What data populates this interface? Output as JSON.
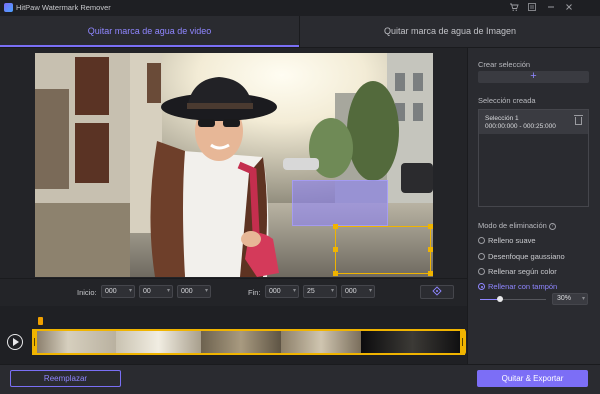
{
  "app": {
    "title": "HitPaw Watermark Remover"
  },
  "window_controls": [
    "cart-icon",
    "menu-icon",
    "minimize-icon",
    "close-icon"
  ],
  "tabs": [
    {
      "label": "Quitar marca de agua de video",
      "active": true
    },
    {
      "label": "Quitar marca de agua de Imagen",
      "active": false
    }
  ],
  "controls": {
    "start_label": "Inicio:",
    "start": [
      "000",
      "00",
      "000"
    ],
    "end_label": "Fin:",
    "end": [
      "000",
      "25",
      "000"
    ]
  },
  "panel": {
    "create_label": "Crear selección",
    "add_symbol": "+",
    "created_label": "Selección creada",
    "selection": {
      "name": "Selección 1",
      "range": "000:00:000 - 000:25:000"
    },
    "mode_label": "Modo de eliminación",
    "modes": [
      {
        "label": "Relleno suave",
        "selected": false
      },
      {
        "label": "Desenfoque gaussiano",
        "selected": false
      },
      {
        "label": "Rellenar según color",
        "selected": false
      },
      {
        "label": "Rellenar con tampón",
        "selected": true
      }
    ],
    "opacity": {
      "value": "30%",
      "level": 0.3
    }
  },
  "buttons": {
    "replace": "Reemplazar",
    "export": "Quitar & Exportar"
  },
  "colors": {
    "accent": "#7c6ef6",
    "handle": "#f0b400",
    "background": "#232428"
  }
}
